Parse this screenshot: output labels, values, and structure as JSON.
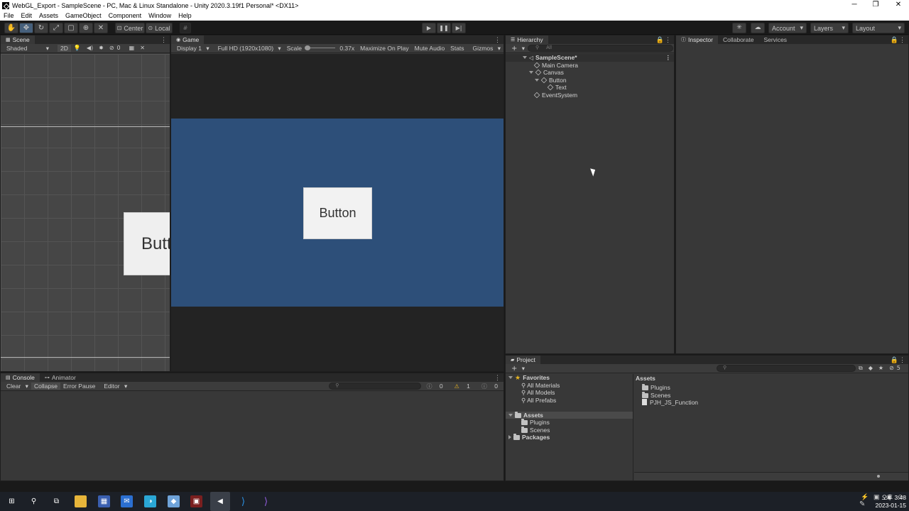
{
  "window": {
    "title": "WebGL_Export - SampleScene - PC, Mac & Linux Standalone - Unity 2020.3.19f1 Personal* <DX11>",
    "controls": {
      "minimize": "─",
      "maximize": "❐",
      "close": "✕"
    }
  },
  "menu": [
    "File",
    "Edit",
    "Assets",
    "GameObject",
    "Component",
    "Window",
    "Help"
  ],
  "toolbar": {
    "pivot": "Center",
    "space": "Local",
    "account": "Account",
    "layers": "Layers",
    "layout": "Layout"
  },
  "scene": {
    "tab": "Scene",
    "shading": "Shaded",
    "mode_2d": "2D",
    "gizmo_count": "0",
    "button_text": "Butt"
  },
  "game": {
    "tab": "Game",
    "display": "Display 1",
    "resolution": "Full HD (1920x1080)",
    "scale_label": "Scale",
    "scale_value": "0.37x",
    "maximize": "Maximize On Play",
    "mute": "Mute Audio",
    "stats": "Stats",
    "gizmos": "Gizmos",
    "button_text": "Button",
    "canvas_color": "#2d4f79"
  },
  "hierarchy": {
    "tab": "Hierarchy",
    "search_placeholder": "All",
    "items": [
      {
        "label": "SampleScene*"
      },
      {
        "label": "Main Camera"
      },
      {
        "label": "Canvas"
      },
      {
        "label": "Button"
      },
      {
        "label": "Text"
      },
      {
        "label": "EventSystem"
      }
    ]
  },
  "inspector": {
    "tabs": [
      "Inspector",
      "Collaborate",
      "Services"
    ]
  },
  "console": {
    "tabs": [
      "Console",
      "Animator"
    ],
    "clear": "Clear",
    "collapse": "Collapse",
    "error_pause": "Error Pause",
    "editor": "Editor",
    "info_count": "0",
    "warn_count": "1",
    "error_count": "0"
  },
  "project": {
    "tab": "Project",
    "favorites_label": "Favorites",
    "favorites": [
      "All Materials",
      "All Models",
      "All Prefabs"
    ],
    "assets_label": "Assets",
    "assets_children": [
      "Plugins",
      "Scenes"
    ],
    "packages_label": "Packages",
    "breadcrumb": "Assets",
    "files": [
      "Plugins",
      "Scenes",
      "PJH_JS_Function"
    ],
    "hidden_count": "5"
  },
  "taskbar": {
    "time": "오후 3:48",
    "date": "2023-01-15"
  }
}
